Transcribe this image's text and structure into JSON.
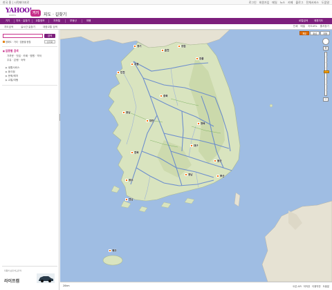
{
  "top_strip": {
    "left_text": "한국 홈 | 시작페이지로",
    "right_links": [
      "로그인",
      "회원가입",
      "메일",
      "뉴스",
      "카페",
      "블로그",
      "전체서비스",
      "도움말"
    ]
  },
  "logo": {
    "text": "YAHOO!",
    "sub": "KOREA"
  },
  "service_badge": "거기",
  "service_title": "지도 · 길찾기",
  "nav": {
    "tabs": [
      "거기",
      "지도 · 길찾기",
      "교통정보",
      "지하철",
      "부동산",
      "여행"
    ],
    "active_index": 1,
    "right_tabs": [
      "로컬검색",
      "제휴지도"
    ]
  },
  "subnav": {
    "items": [
      "지도검색",
      "실시간 길찾기",
      "대중교통 검색"
    ],
    "active_index": 0,
    "right_links": [
      "인쇄",
      "메일",
      "지도URL",
      "즐겨찾기"
    ]
  },
  "left_panel": {
    "search_placeholder": "",
    "search_button": "검색",
    "sort_label": "정확도 · 거리 · 업종별 정렬",
    "reset_button": "초기화",
    "section_title": "업종별 검색",
    "quick_rows": [
      "가까운 · 맛집 · 카페 · 병원 · 약국",
      "주유 · 은행 · 숙박"
    ],
    "tree_items": [
      "생활서비스",
      "음식점",
      "문화/레저",
      "교통/여행"
    ],
    "ad_small": "자동차 보험 비교견적",
    "ad_brand": "라이프캠"
  },
  "map": {
    "type_buttons": [
      "지도",
      "위성",
      "지형"
    ],
    "active_type_index": 0,
    "zoom_level_fraction": 0.45,
    "cities": [
      {
        "name": "서울"
      },
      {
        "name": "인천"
      },
      {
        "name": "춘천"
      },
      {
        "name": "강릉"
      },
      {
        "name": "경기"
      },
      {
        "name": "강원"
      },
      {
        "name": "충북"
      },
      {
        "name": "충남"
      },
      {
        "name": "대전"
      },
      {
        "name": "경북"
      },
      {
        "name": "전북"
      },
      {
        "name": "대구"
      },
      {
        "name": "광주"
      },
      {
        "name": "전남"
      },
      {
        "name": "경남"
      },
      {
        "name": "부산"
      },
      {
        "name": "울산"
      },
      {
        "name": "제주"
      }
    ]
  },
  "bottom": {
    "scale_text": "20km",
    "links": [
      "오픈 API",
      "저작권",
      "이용약관",
      "도움말"
    ]
  },
  "colors": {
    "brand_purple": "#7d1f7d",
    "badge_magenta": "#c7308a",
    "sea": "#9fbde3",
    "land": "#d9e4bf",
    "active_type": "#e06b00"
  }
}
